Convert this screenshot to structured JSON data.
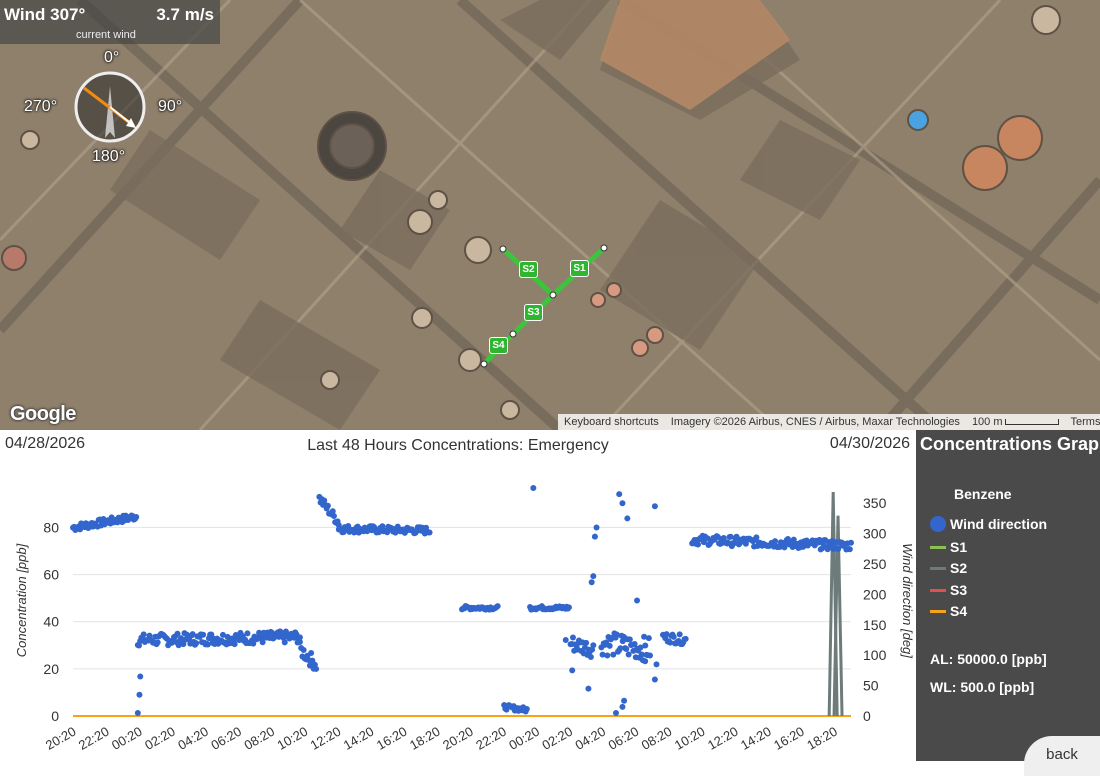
{
  "wind": {
    "title": "Wind 307°",
    "speed": "3.7 m/s",
    "subtitle": "current wind",
    "compass": {
      "n": "0°",
      "e": "90°",
      "s": "180°",
      "w": "270°"
    },
    "direction_deg": 307
  },
  "map": {
    "provider_logo": "Google",
    "keyboard_shortcuts": "Keyboard shortcuts",
    "imagery": "Imagery ©2026 Airbus, CNES / Airbus, Maxar Technologies",
    "scale": "100 m",
    "terms": "Terms",
    "stations": [
      {
        "label": "S1"
      },
      {
        "label": "S2"
      },
      {
        "label": "S3"
      },
      {
        "label": "S4"
      }
    ],
    "path_color": "#3cc43c"
  },
  "chart_header": {
    "date_start": "04/28/2026",
    "date_end": "04/30/2026",
    "title": "Last 48 Hours Concentrations: Emergency"
  },
  "chart_data": {
    "type": "scatter",
    "title": "Last 48 Hours Concentrations: Emergency",
    "x_tick_labels": [
      "20:20",
      "22:20",
      "00:20",
      "02:20",
      "04:20",
      "06:20",
      "08:20",
      "10:20",
      "12:20",
      "14:20",
      "16:20",
      "18:20",
      "20:20",
      "22:20",
      "00:20",
      "02:20",
      "04:20",
      "06:20",
      "08:20",
      "10:20",
      "12:20",
      "14:20",
      "16:20",
      "18:20"
    ],
    "y_left": {
      "label": "Concentration [ppb]",
      "ticks": [
        0,
        20,
        40,
        60,
        80
      ],
      "range": [
        0,
        98
      ]
    },
    "y_right": {
      "label": "Wind direction [deg]",
      "ticks": [
        0,
        50,
        100,
        150,
        200,
        250,
        300,
        350
      ],
      "range": [
        0,
        380
      ]
    },
    "grid": true,
    "legend_position": "right",
    "series": [
      {
        "name": "Wind direction",
        "axis": "right",
        "color": "#3366cc",
        "segments": [
          {
            "hours": [
              0.0,
              3.9
            ],
            "base": [
              310,
              328
            ],
            "spread": 6
          },
          {
            "hours": [
              4.0,
              14.0
            ],
            "base": [
              125,
              130
            ],
            "spread": 10
          },
          {
            "hours": [
              14.0,
              15.0
            ],
            "base": [
              110,
              85
            ],
            "spread": 12
          },
          {
            "hours": [
              15.2,
              16.4
            ],
            "base": [
              358,
              318
            ],
            "spread": 8
          },
          {
            "hours": [
              16.4,
              22.0
            ],
            "base": [
              308,
              305
            ],
            "spread": 6
          },
          {
            "hours": [
              24.0,
              26.2
            ],
            "base": [
              178,
              178
            ],
            "spread": 3
          },
          {
            "hours": [
              26.6,
              28.0
            ],
            "base": [
              15,
              10
            ],
            "spread": 4
          },
          {
            "hours": [
              28.2,
              30.6
            ],
            "base": [
              178,
              178
            ],
            "spread": 3
          },
          {
            "hours": [
              30.7,
              32.1
            ],
            "base": [
              120,
              110
            ],
            "spread": 14
          },
          {
            "hours": [
              32.6,
              35.6
            ],
            "base": [
              120,
              110
            ],
            "spread": 20
          },
          {
            "hours": [
              36.4,
              37.8
            ],
            "base": [
              130,
              125
            ],
            "spread": 8
          },
          {
            "hours": [
              38.2,
              48.0
            ],
            "base": [
              290,
              280
            ],
            "spread": 8
          }
        ],
        "outliers": [
          [
            4.0,
            5
          ],
          [
            4.1,
            35
          ],
          [
            4.15,
            65
          ],
          [
            28.4,
            375
          ],
          [
            30.4,
            125
          ],
          [
            30.8,
            75
          ],
          [
            31.8,
            45
          ],
          [
            32.2,
            295
          ],
          [
            32.3,
            310
          ],
          [
            32.0,
            220
          ],
          [
            32.1,
            230
          ],
          [
            33.5,
            5
          ],
          [
            33.7,
            365
          ],
          [
            33.9,
            350
          ],
          [
            34.2,
            325
          ],
          [
            34.8,
            190
          ],
          [
            34.0,
            25
          ],
          [
            33.9,
            15
          ],
          [
            35.9,
            345
          ],
          [
            35.3,
            90
          ],
          [
            36.0,
            85
          ],
          [
            35.9,
            60
          ]
        ]
      },
      {
        "name": "S1",
        "axis": "left",
        "color": "#8cc152",
        "values_note": "0"
      },
      {
        "name": "S2",
        "axis": "left",
        "color": "#6d7b7b",
        "spikes": [
          {
            "x_hour": 46.9,
            "value": 95
          },
          {
            "x_hour": 47.2,
            "value": 85
          }
        ]
      },
      {
        "name": "S3",
        "axis": "left",
        "color": "#e05050",
        "values_note": "0"
      },
      {
        "name": "S4",
        "axis": "left",
        "color": "#f7a21b",
        "values_note": "0"
      }
    ]
  },
  "side_panel": {
    "title": "Concentrations Graph",
    "pollutant": "Benzene",
    "legend": [
      {
        "label": "Wind direction",
        "kind": "dot",
        "color": "#3366cc"
      },
      {
        "label": "S1",
        "kind": "line",
        "color": "#8cc152"
      },
      {
        "label": "S2",
        "kind": "line",
        "color": "#6d7b7b"
      },
      {
        "label": "S3",
        "kind": "line",
        "color": "#e05050"
      },
      {
        "label": "S4",
        "kind": "line",
        "color": "#f7a21b"
      }
    ],
    "al": "AL: 50000.0 [ppb]",
    "wl": "WL: 500.0 [ppb]",
    "back": "back"
  }
}
